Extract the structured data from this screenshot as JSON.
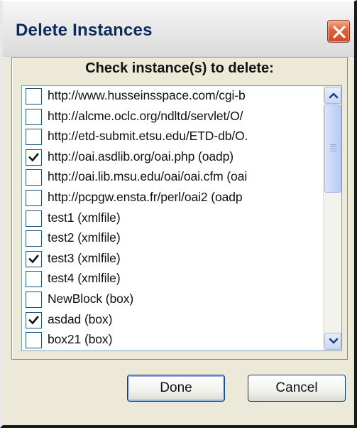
{
  "window": {
    "title": "Delete Instances"
  },
  "group": {
    "caption": "Check instance(s) to delete:"
  },
  "instances": [
    {
      "label": "http://www.husseinsspace.com/cgi-b",
      "checked": false
    },
    {
      "label": "http://alcme.oclc.org/ndltd/servlet/O/",
      "checked": false
    },
    {
      "label": "http://etd-submit.etsu.edu/ETD-db/O.",
      "checked": false
    },
    {
      "label": "http://oai.asdlib.org/oai.php (oadp)",
      "checked": true
    },
    {
      "label": "http://oai.lib.msu.edu/oai/oai.cfm (oai",
      "checked": false
    },
    {
      "label": "http://pcpgw.ensta.fr/perl/oai2 (oadp",
      "checked": false
    },
    {
      "label": "test1 (xmlfile)",
      "checked": false
    },
    {
      "label": "test2 (xmlfile)",
      "checked": false
    },
    {
      "label": "test3 (xmlfile)",
      "checked": true
    },
    {
      "label": "test4 (xmlfile)",
      "checked": false
    },
    {
      "label": "NewBlock (box)",
      "checked": false
    },
    {
      "label": "asdad (box)",
      "checked": true
    },
    {
      "label": "box21 (box)",
      "checked": false
    }
  ],
  "buttons": {
    "done": "Done",
    "cancel": "Cancel"
  },
  "icons": {
    "close": "close-icon",
    "check": "checkmark-icon",
    "scroll_up": "chevron-up-icon",
    "scroll_down": "chevron-down-icon"
  },
  "colors": {
    "title_text": "#0b2a5e",
    "close_button": "#e3623b",
    "list_border": "#7f9db9",
    "button_border": "#003c74"
  }
}
